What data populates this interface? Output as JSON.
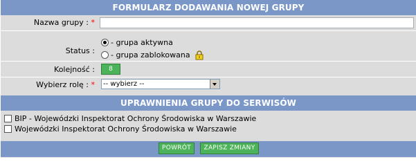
{
  "form_title": "FORMULARZ DODAWANIA NOWEJ GRUPY",
  "fields": {
    "name": {
      "label": "Nazwa grupy :",
      "required_mark": "*",
      "value": ""
    },
    "status": {
      "label": "Status :",
      "options": [
        {
          "label": "- grupa aktywna",
          "selected": true
        },
        {
          "label": "- grupa zablokowana",
          "selected": false,
          "icon": "lock-icon"
        }
      ]
    },
    "order": {
      "label": "Kolejność :",
      "value": "8"
    },
    "role": {
      "label": "Wybierz rolę :",
      "required_mark": "*",
      "selected": "-- wybierz --"
    }
  },
  "permissions_title": "UPRAWNIENIA GRUPY DO SERWISÓW",
  "services": [
    {
      "label": "BIP - Wojewódzki Inspektorat Ochrony Środowiska w Warszawie",
      "checked": false
    },
    {
      "label": "Wojewódzki Inspektorat Ochrony Środowiska w Warszawie",
      "checked": false
    }
  ],
  "buttons": {
    "back": "POWRÓT",
    "save": "ZAPISZ ZMIANY"
  },
  "colors": {
    "header_bg": "#7a97c7",
    "button_bg": "#4db35a",
    "form_bg": "#dcdcdc",
    "required": "#ff0000"
  }
}
